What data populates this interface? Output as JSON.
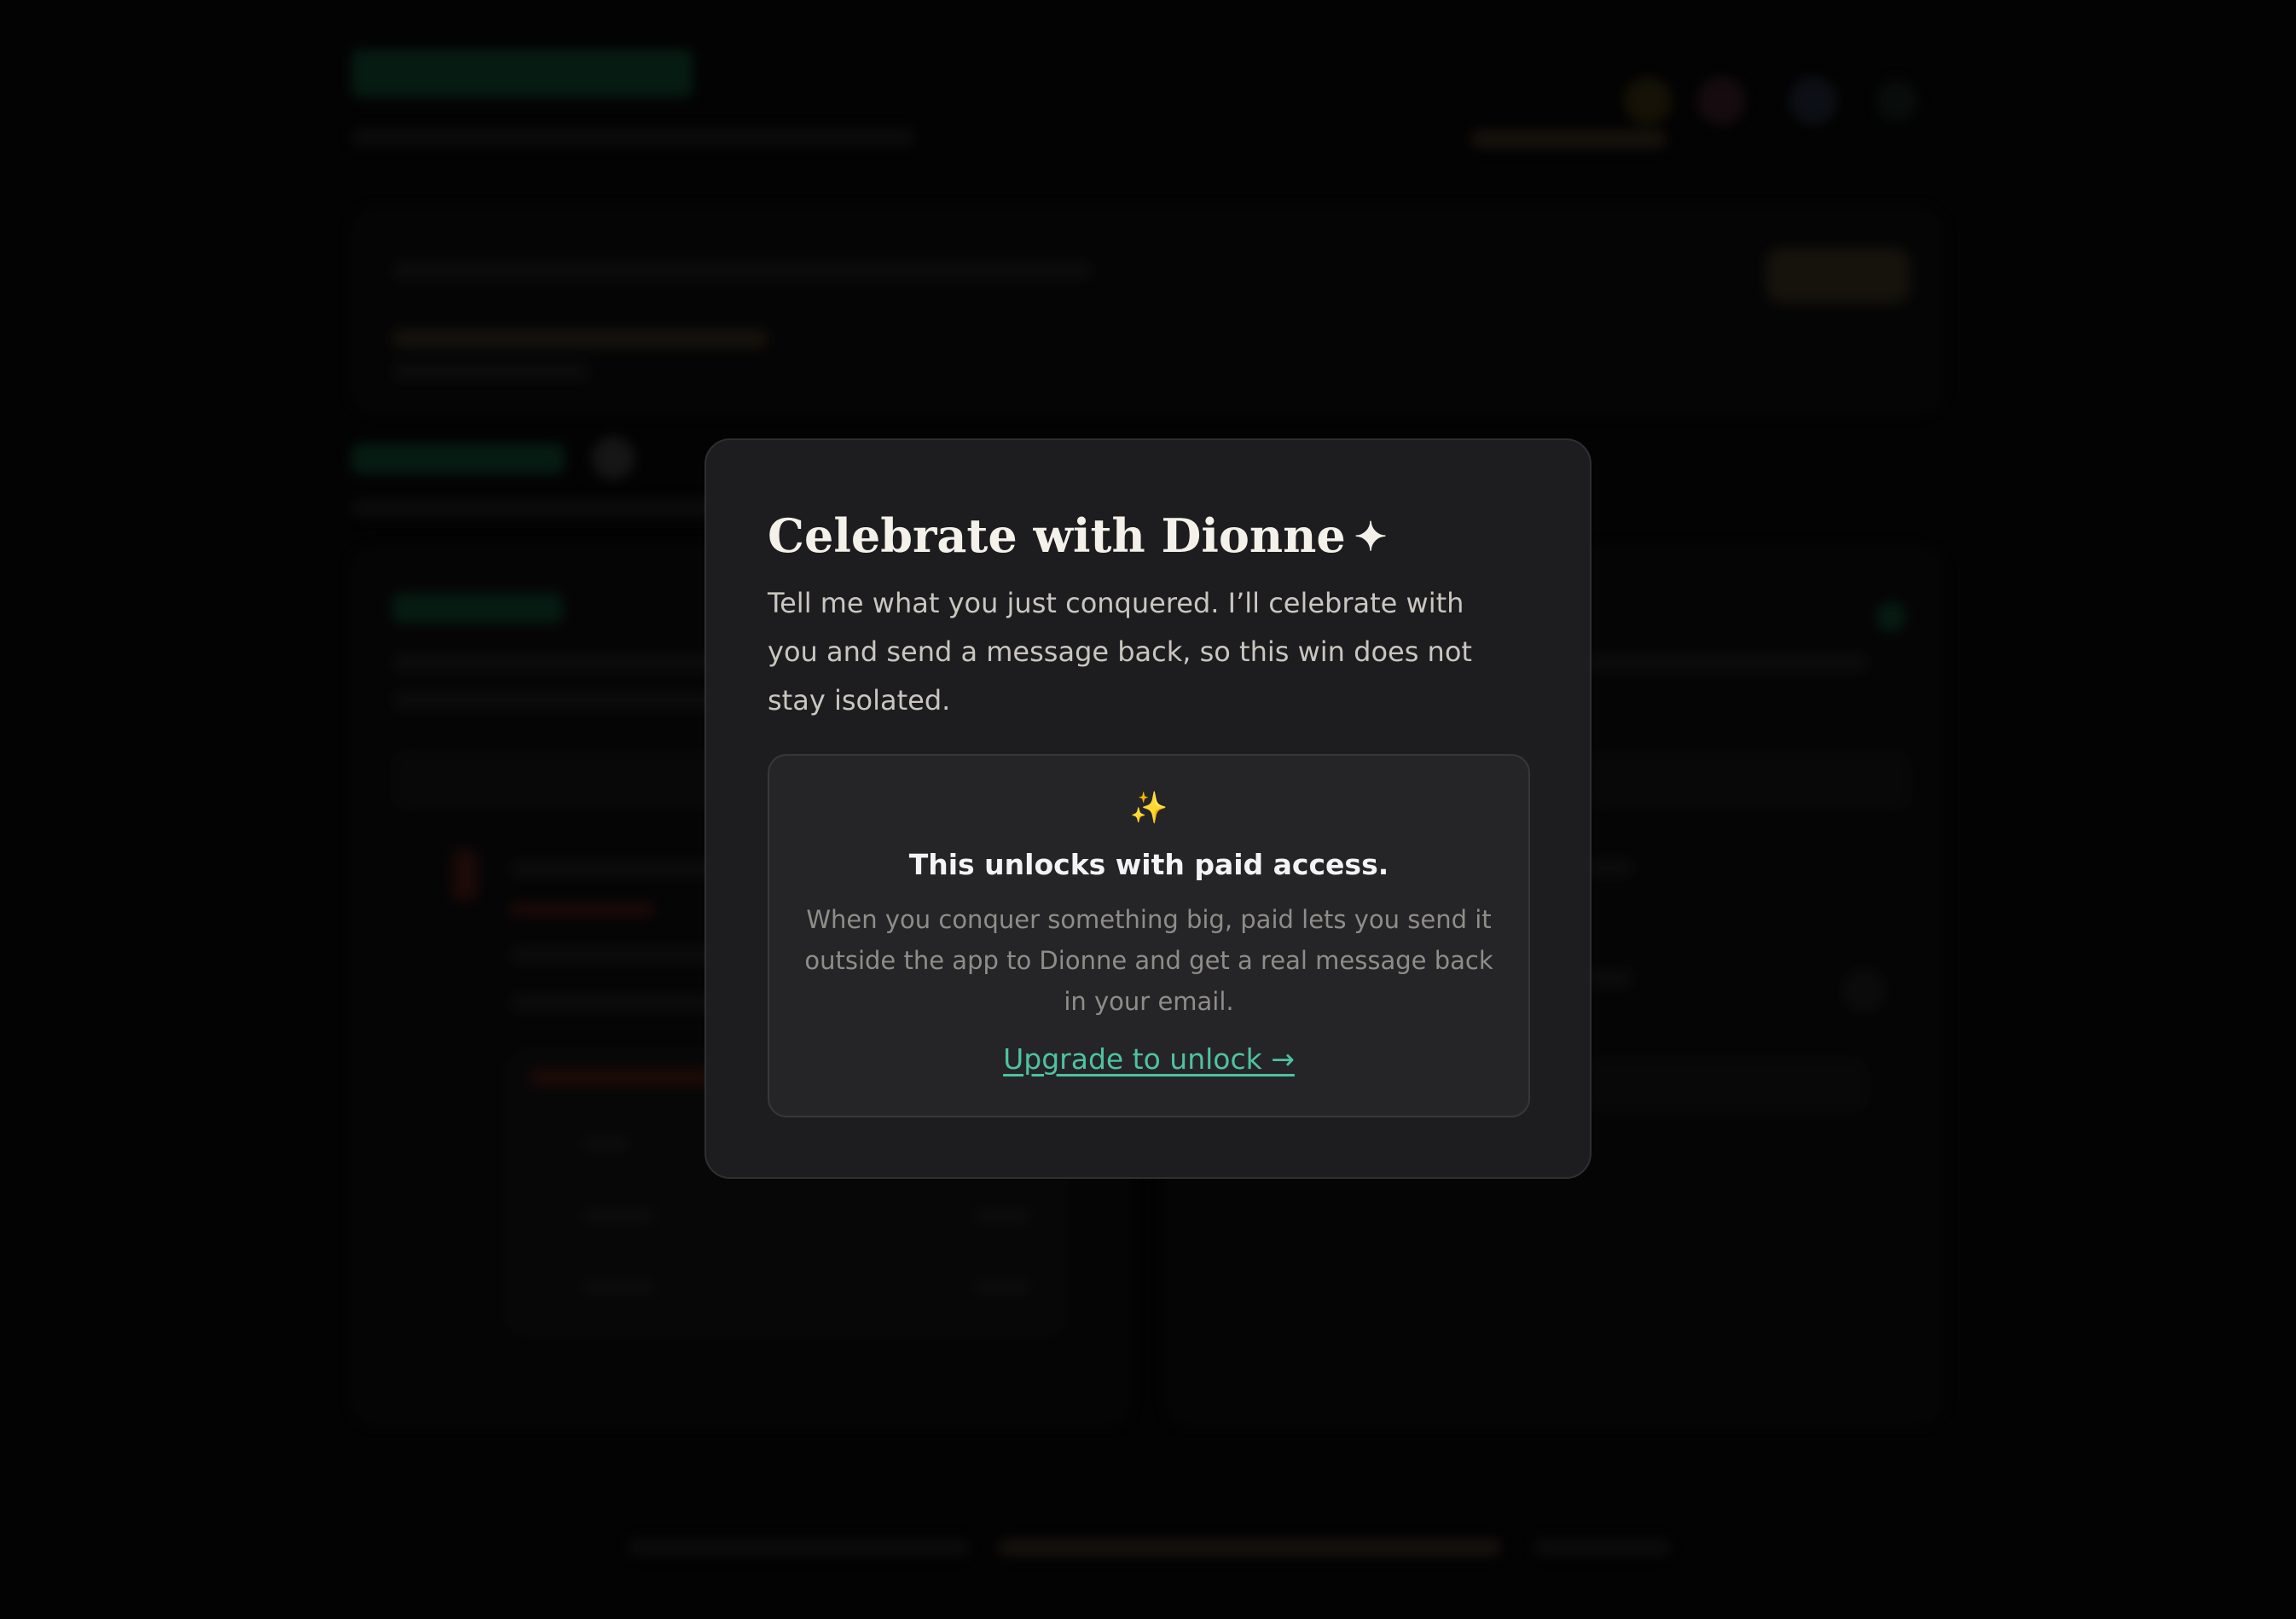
{
  "modal": {
    "title": "Celebrate with Dionne",
    "title_icon": "sparkle-icon",
    "description": "Tell me what you just conquered. I’ll celebrate with you and send a message back, so this win does not stay isolated.",
    "paid_gate": {
      "icon": "sparkles-emoji-icon",
      "heading": "This unlocks with paid access.",
      "body": "When you conquer something big, paid lets you send it outside the app to Dionne and get a real message back in your email.",
      "link_label": "Upgrade to unlock →"
    }
  },
  "colors": {
    "modal_bg": "#1d1d1f",
    "accent_link": "#4fc2a0",
    "sparkle": "#f2c14e",
    "title_text": "#f4f1ea"
  }
}
